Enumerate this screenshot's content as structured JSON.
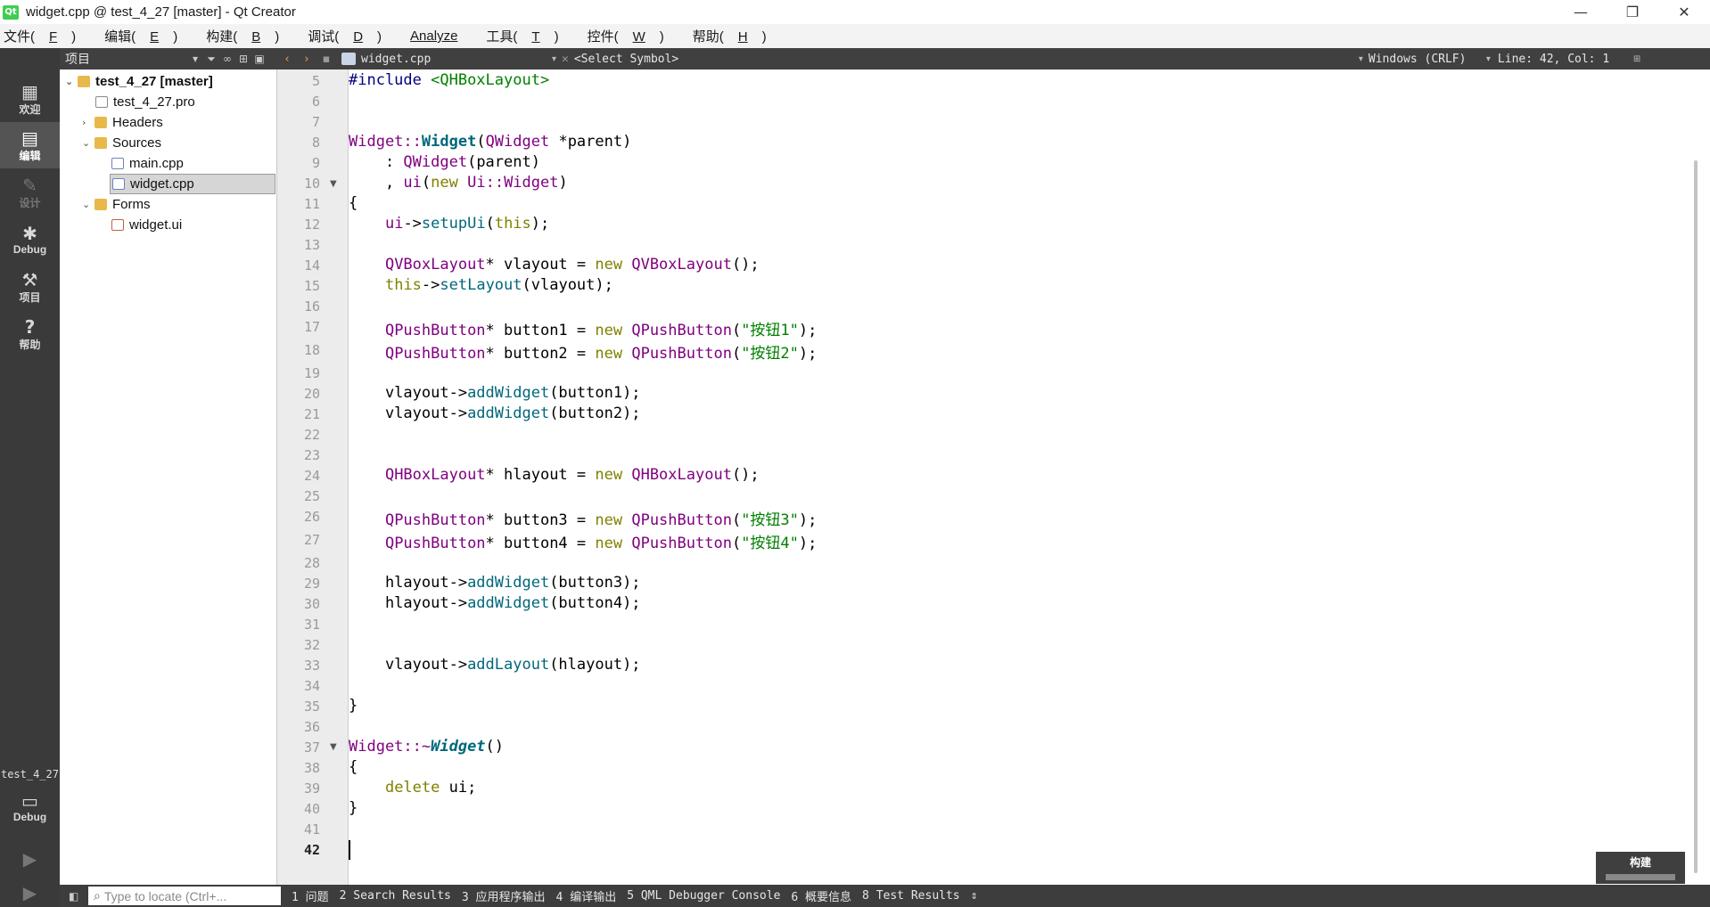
{
  "window": {
    "title": "widget.cpp @ test_4_27 [master] - Qt Creator",
    "minimize": "—",
    "restore": "❐",
    "close": "✕"
  },
  "menu": [
    {
      "label": "文件(",
      "key": "F",
      "tail": ")"
    },
    {
      "label": "编辑(",
      "key": "E",
      "tail": ")"
    },
    {
      "label": "构建(",
      "key": "B",
      "tail": ")"
    },
    {
      "label": "调试(",
      "key": "D",
      "tail": ")"
    },
    {
      "label": "",
      "key": "Analyze",
      "tail": ""
    },
    {
      "label": "工具(",
      "key": "T",
      "tail": ")"
    },
    {
      "label": "控件(",
      "key": "W",
      "tail": ")"
    },
    {
      "label": "帮助(",
      "key": "H",
      "tail": ")"
    }
  ],
  "modes": {
    "welcome": "欢迎",
    "edit": "编辑",
    "design": "设计",
    "debug": "Debug",
    "projects": "项目",
    "help": "帮助",
    "kit_name": "test_4_27",
    "kit_mode": "Debug"
  },
  "project_panel": {
    "label": "项目",
    "tree": {
      "root": "test_4_27 [master]",
      "pro_file": "test_4_27.pro",
      "headers": "Headers",
      "sources": "Sources",
      "main_cpp": "main.cpp",
      "widget_cpp": "widget.cpp",
      "forms": "Forms",
      "widget_ui": "widget.ui"
    }
  },
  "editor_toolbar": {
    "file": "widget.cpp",
    "symbol": "<Select Symbol>",
    "line_ending": "Windows (CRLF)",
    "position": "Line: 42, Col: 1"
  },
  "code": {
    "line_numbers": [
      "5",
      "6",
      "7",
      "8",
      "9",
      "10",
      "11",
      "12",
      "13",
      "14",
      "15",
      "16",
      "17",
      "18",
      "19",
      "20",
      "21",
      "22",
      "23",
      "24",
      "25",
      "26",
      "27",
      "28",
      "29",
      "30",
      "31",
      "32",
      "33",
      "34",
      "35",
      "36",
      "37",
      "38",
      "39",
      "40",
      "41",
      "42"
    ],
    "l5_a": "#include ",
    "l5_b": "<QHBoxLayout>",
    "l8_a": "Widget::",
    "l8_b": "Widget",
    "l8_c": "(",
    "l8_d": "QWidget",
    "l8_e": " *parent)",
    "l9_a": "    : ",
    "l9_b": "QWidget",
    "l9_c": "(parent)",
    "l10_a": "    , ",
    "l10_b": "ui",
    "l10_c": "(",
    "l10_d": "new",
    "l10_e": " ",
    "l10_f": "Ui::Widget",
    "l10_g": ")",
    "l11": "{",
    "l12_a": "    ",
    "l12_b": "ui",
    "l12_c": "->",
    "l12_d": "setupUi",
    "l12_e": "(",
    "l12_f": "this",
    "l12_g": ");",
    "l14_a": "    ",
    "l14_b": "QVBoxLayout",
    "l14_c": "* vlayout = ",
    "l14_d": "new",
    "l14_e": " ",
    "l14_f": "QVBoxLayout",
    "l14_g": "();",
    "l15_a": "    ",
    "l15_b": "this",
    "l15_c": "->",
    "l15_d": "setLayout",
    "l15_e": "(vlayout);",
    "l17_a": "    ",
    "l17_b": "QPushButton",
    "l17_c": "* button1 = ",
    "l17_d": "new",
    "l17_e": " ",
    "l17_f": "QPushButton",
    "l17_g": "(",
    "l17_h": "\"按钮1\"",
    "l17_i": ");",
    "l18_a": "    ",
    "l18_b": "QPushButton",
    "l18_c": "* button2 = ",
    "l18_d": "new",
    "l18_e": " ",
    "l18_f": "QPushButton",
    "l18_g": "(",
    "l18_h": "\"按钮2\"",
    "l18_i": ");",
    "l20_a": "    vlayout->",
    "l20_b": "addWidget",
    "l20_c": "(button1);",
    "l21_a": "    vlayout->",
    "l21_b": "addWidget",
    "l21_c": "(button2);",
    "l24_a": "    ",
    "l24_b": "QHBoxLayout",
    "l24_c": "* hlayout = ",
    "l24_d": "new",
    "l24_e": " ",
    "l24_f": "QHBoxLayout",
    "l24_g": "();",
    "l26_a": "    ",
    "l26_b": "QPushButton",
    "l26_c": "* button3 = ",
    "l26_d": "new",
    "l26_e": " ",
    "l26_f": "QPushButton",
    "l26_g": "(",
    "l26_h": "\"按钮3\"",
    "l26_i": ");",
    "l27_a": "    ",
    "l27_b": "QPushButton",
    "l27_c": "* button4 = ",
    "l27_d": "new",
    "l27_e": " ",
    "l27_f": "QPushButton",
    "l27_g": "(",
    "l27_h": "\"按钮4\"",
    "l27_i": ");",
    "l29_a": "    hlayout->",
    "l29_b": "addWidget",
    "l29_c": "(button3);",
    "l30_a": "    hlayout->",
    "l30_b": "addWidget",
    "l30_c": "(button4);",
    "l33_a": "    vlayout->",
    "l33_b": "addLayout",
    "l33_c": "(hlayout);",
    "l35": "}",
    "l37_a": "Widget::~",
    "l37_b": "Widget",
    "l37_c": "()",
    "l38": "{",
    "l39_a": "    ",
    "l39_b": "delete",
    "l39_c": " ui;",
    "l40": "}"
  },
  "build_indicator": "构建",
  "statusbar": {
    "locate_placeholder": "Type to locate (Ctrl+...",
    "panels": [
      "1 问题",
      "2 Search Results",
      "3 应用程序输出",
      "4 编译输出",
      "5 QML Debugger Console",
      "6 概要信息",
      "8 Test Results"
    ]
  },
  "colors": {
    "keyword": "#808000",
    "type": "#800080",
    "function": "#00677c",
    "string": "#008000",
    "sidebar": "#3a3a3a"
  }
}
